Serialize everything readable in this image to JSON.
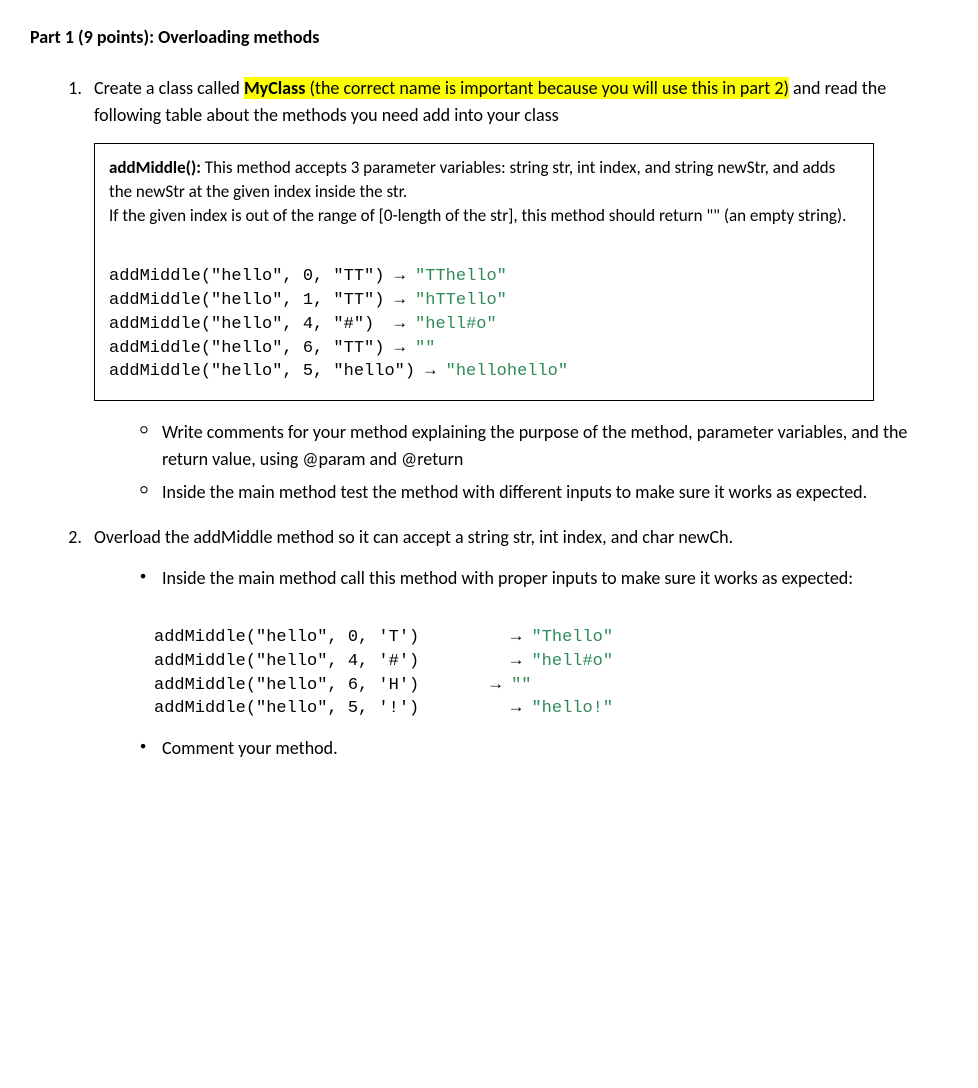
{
  "heading": "Part 1 (9 points): Overloading methods",
  "item1": {
    "pre": "Create a class called ",
    "classname": "MyClass",
    "hl": " (the correct name is important because you will use this in part 2)",
    "post": " and read the following table about the methods you need add into your class"
  },
  "box": {
    "method_name": "addMiddle():",
    "desc1": " This method accepts 3 parameter variables: string str, int index, and string newStr, and adds the newStr at the given index inside the str.",
    "desc2": "If the given index is out of the range of [0-length of the str], this method should return \"\" (an empty string).",
    "lines": [
      {
        "call": "addMiddle(\"hello\", 0, \"TT\") → ",
        "out": "\"TThello\""
      },
      {
        "call": "addMiddle(\"hello\", 1, \"TT\") → ",
        "out": "\"hTTello\""
      },
      {
        "call": "addMiddle(\"hello\", 4, \"#\")  → ",
        "out": "\"hell#o\""
      },
      {
        "call": "addMiddle(\"hello\", 6, \"TT\") → ",
        "out": "\"\""
      },
      {
        "call": "addMiddle(\"hello\", 5, \"hello\") → ",
        "out": "\"hellohello\""
      }
    ]
  },
  "sub1": {
    "a": "Write comments for your method explaining the purpose of the method, parameter variables, and the return value, using @param and @return",
    "b": "Inside the main method test the method with different inputs to make sure it works as expected."
  },
  "item2": {
    "text": "Overload the addMiddle method so it can accept a string str, int index, and char newCh.",
    "bullet1": "Inside the main method call this method with proper inputs to make sure it works as expected:",
    "bullet2": "Comment your method.",
    "lines": [
      {
        "call": "addMiddle(\"hello\", 0, 'T')         → ",
        "out": "\"Thello\""
      },
      {
        "call": "addMiddle(\"hello\", 4, '#')         → ",
        "out": "\"hell#o\""
      },
      {
        "call": "addMiddle(\"hello\", 6, 'H')       → ",
        "out": "\"\""
      },
      {
        "call": "addMiddle(\"hello\", 5, '!')         → ",
        "out": "\"hello!\""
      }
    ]
  }
}
